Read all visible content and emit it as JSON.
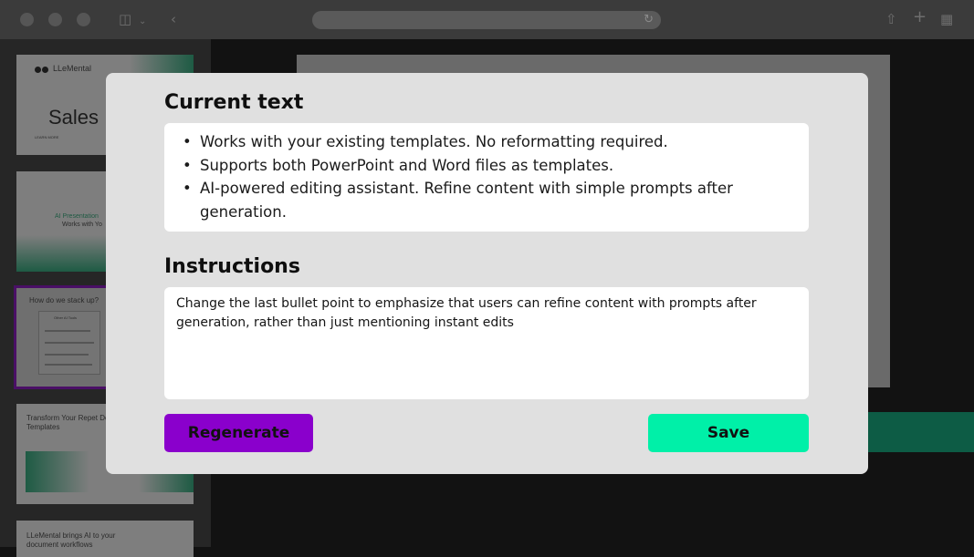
{
  "browser": {
    "icons": [
      "sidebar-toggle-icon",
      "chevron-down-icon",
      "back-icon",
      "reload-icon",
      "share-icon",
      "new-tab-icon",
      "tab-overview-icon"
    ]
  },
  "sidebar": {
    "slides": [
      {
        "logo": "LLeMental",
        "title": "Sales",
        "sub": "LEARN MORE"
      },
      {
        "title": "AI Presentation",
        "sub": "Works with Yo"
      },
      {
        "title": "How do we stack up?",
        "box_title": "Other AI Tools"
      },
      {
        "title": "Transform Your Repet Documents into AI-Po Templates"
      },
      {
        "title": "LLeMental brings AI to your document workflows"
      }
    ]
  },
  "modal": {
    "current_title": "Current text",
    "current_bullets": [
      "Works with your existing templates. No reformatting required.",
      "Supports both PowerPoint and Word files as templates.",
      "AI-powered editing assistant. Refine content with simple prompts after generation."
    ],
    "instructions_title": "Instructions",
    "instructions_value": "Change the last bullet point to emphasize that users can refine content with prompts after generation, rather than just mentioning instant edits",
    "regenerate_label": "Regenerate",
    "save_label": "Save"
  },
  "colors": {
    "regenerate_button": "#8a00cc",
    "save_button": "#00f0a8",
    "modal_background": "#e0e0e0"
  }
}
